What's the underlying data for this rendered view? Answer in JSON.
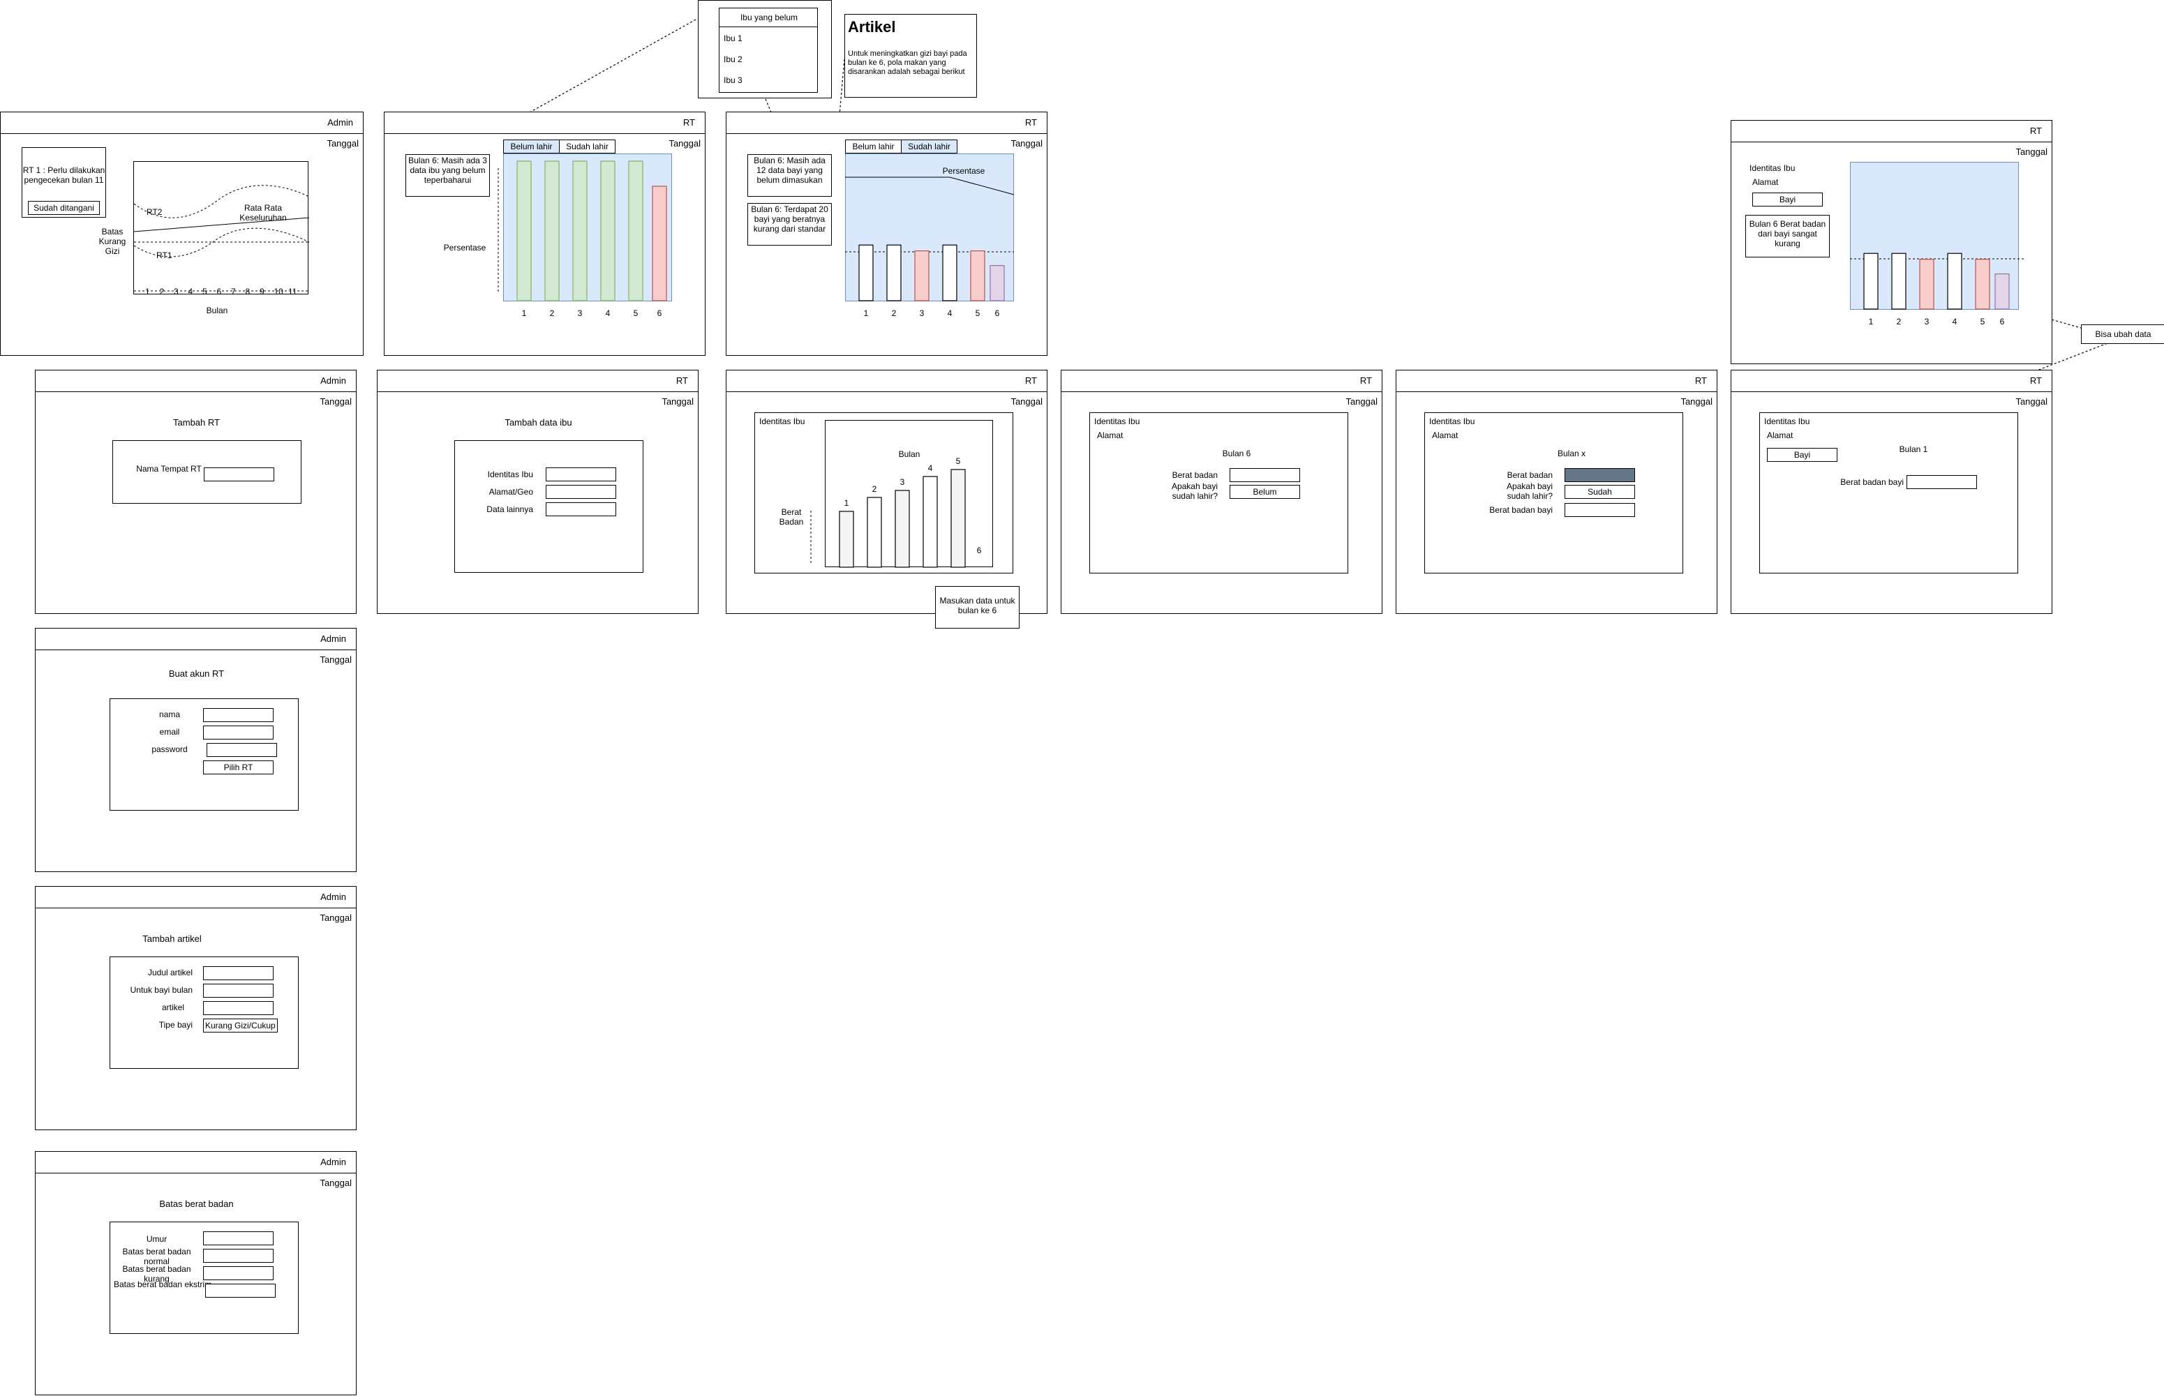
{
  "roles": {
    "admin": "Admin",
    "rt": "RT"
  },
  "common": {
    "date": "Tanggal"
  },
  "colors": {
    "green_bar": "#d5e8d4",
    "red_bar": "#f8cecc",
    "purple_bar": "#e1d5e7",
    "blue_panel": "#dae8fc",
    "gray_bar": "#f5f5f5",
    "dark_field": "#647687"
  },
  "admin_dashboard": {
    "alert": "RT 1 : Perlu dilakukan pengecekan bulan 11",
    "handled_button": "Sudah ditangani",
    "y_label": "Batas Kurang Gizi",
    "x_label": "Bulan",
    "series": {
      "rt2": "RT2",
      "rt1": "RT1",
      "avg": "Rata Rata Keseluruhan"
    },
    "x_ticks": [
      "1",
      "2",
      "3",
      "4",
      "5",
      "6",
      "7",
      "8",
      "9",
      "10",
      "11"
    ]
  },
  "popup_mothers": {
    "title": "Ibu yang belum",
    "items": [
      "Ibu 1",
      "Ibu 2",
      "Ibu 3"
    ]
  },
  "article_popup": {
    "title": "Artikel",
    "body": "Untuk meningkatkan gizi bayi pada bulan ke 6, pola makan yang disarankan adalah sebagai berikut"
  },
  "rt_dashboard_unborn": {
    "tabs": [
      "Belum lahir",
      "Sudah lahir"
    ],
    "note": "Bulan 6: Masih ada 3 data ibu yang belum teperbaharui",
    "y_label": "Persentase",
    "chart_data": {
      "type": "bar",
      "categories": [
        "1",
        "2",
        "3",
        "4",
        "5",
        "6"
      ],
      "values": [
        100,
        100,
        100,
        100,
        100,
        82
      ],
      "colors": [
        "green",
        "green",
        "green",
        "green",
        "green",
        "red"
      ],
      "ylabel": "Persentase"
    }
  },
  "rt_dashboard_born": {
    "tabs": [
      "Belum lahir",
      "Sudah lahir"
    ],
    "note1": "Bulan 6: Masih ada 12 data bayi yang belum dimasukan",
    "note2": "Bulan 6: Terdapat 20 bayi yang beratnya kurang dari standar",
    "line_label": "Persentase",
    "chart_data": {
      "type": "bar",
      "categories": [
        "1",
        "2",
        "3",
        "4",
        "5",
        "6"
      ],
      "values": [
        38,
        38,
        34,
        38,
        34,
        24
      ],
      "colors": [
        "white",
        "white",
        "red",
        "white",
        "red",
        "purple"
      ]
    }
  },
  "baby_detail": {
    "mother_id": "Identitas Ibu",
    "address": "Alamat",
    "baby_button": "Bayi",
    "note": "Bulan 6 Berat badan dari bayi sangat kurang",
    "callout": "Bisa ubah data",
    "chart_data": {
      "type": "bar",
      "categories": [
        "1",
        "2",
        "3",
        "4",
        "5",
        "6"
      ],
      "values": [
        38,
        38,
        34,
        38,
        34,
        24
      ],
      "colors": [
        "white",
        "white",
        "red",
        "white",
        "red",
        "purple"
      ]
    }
  },
  "add_rt": {
    "title": "Tambah RT",
    "field_label": "Nama Tempat RT"
  },
  "add_mother": {
    "title": "Tambah data ibu",
    "fields": [
      "Identitas Ibu",
      "Alamat/Geo",
      "Data lainnya"
    ]
  },
  "weight_chart": {
    "mother_id": "Identitas Ibu",
    "x_label": "Bulan",
    "y_label": "Berat Badan",
    "callout": "Masukan data untuk bulan ke 6",
    "chart_data": {
      "type": "bar",
      "categories": [
        "1",
        "2",
        "3",
        "4",
        "5",
        "6"
      ],
      "values": [
        4,
        5,
        5.5,
        6.5,
        7,
        0
      ],
      "xlabel": "Bulan",
      "ylabel": "Berat Badan"
    }
  },
  "month6_form": {
    "mother_id": "Identitas Ibu",
    "address": "Alamat",
    "month": "Bulan 6",
    "weight_label": "Berat badan",
    "born_label": "Apakah bayi sudah lahir?",
    "born_value": "Belum"
  },
  "monthx_form": {
    "mother_id": "Identitas Ibu",
    "address": "Alamat",
    "month": "Bulan x",
    "weight_label": "Berat badan",
    "born_label": "Apakah bayi sudah lahir?",
    "born_value": "Sudah",
    "baby_weight_label": "Berat badan bayi"
  },
  "month1_form": {
    "mother_id": "Identitas Ibu",
    "address": "Alamat",
    "baby_button": "Bayi",
    "month": "Bulan 1",
    "baby_weight_label": "Berat badan bayi"
  },
  "create_rt_account": {
    "title": "Buat akun RT",
    "fields": [
      "nama",
      "email",
      "password"
    ],
    "pick_button": "Pilih RT"
  },
  "add_article": {
    "title": "Tambah artikel",
    "fields": [
      "Judul artikel",
      "Untuk bayi bulan",
      "artikel",
      "Tipe bayi"
    ],
    "type_value": "Kurang Gizi/Cukup"
  },
  "weight_limits": {
    "title": "Batas berat badan",
    "fields": [
      "Umur",
      "Batas berat badan normal",
      "Batas berat badan kurang",
      "Batas berat badan ekstrim"
    ]
  }
}
